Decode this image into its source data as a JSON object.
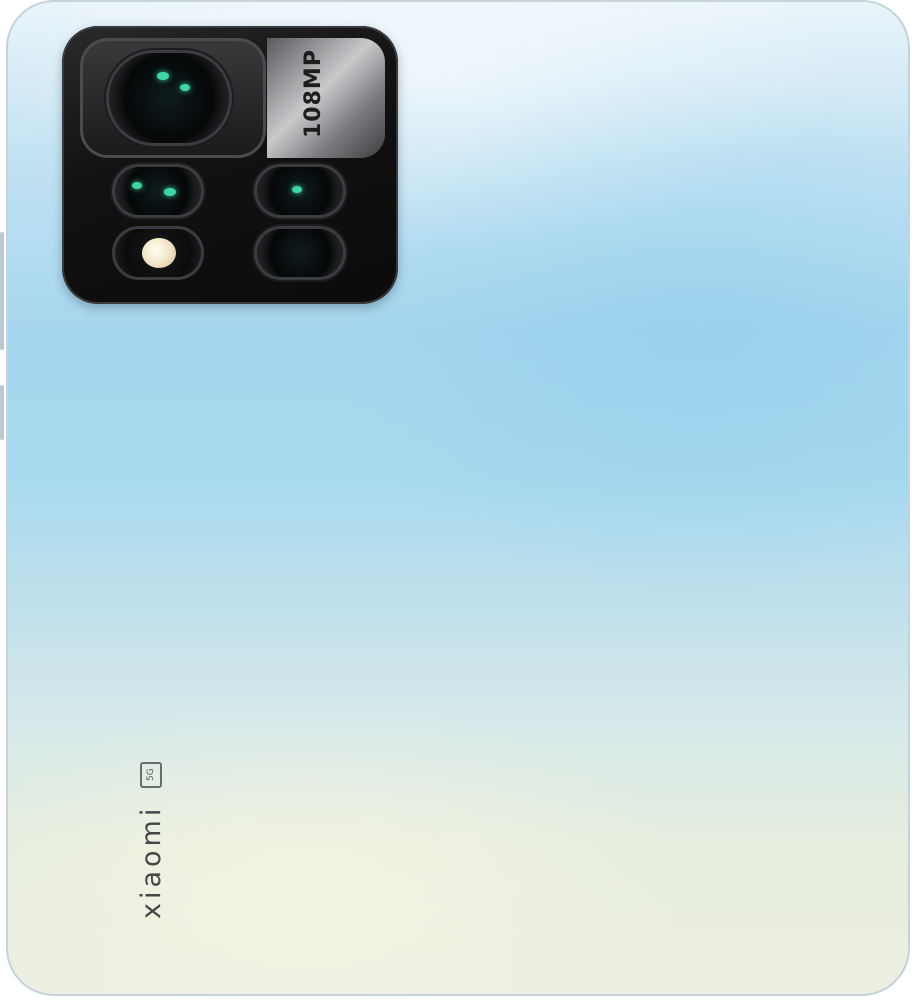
{
  "device": {
    "name": "phone-rear",
    "camera_plate_text": "108MP",
    "camera_plate_subtext": "",
    "brand_text": "xiaomi",
    "network_badge": "5G"
  },
  "colors": {
    "body_top": "#eaf4fa",
    "body_mid": "#a6d6ee",
    "body_bottom": "#ecefe1",
    "camera_module": "#121213",
    "lens_glint": "#3fd6a5",
    "brand_text": "#454846"
  }
}
